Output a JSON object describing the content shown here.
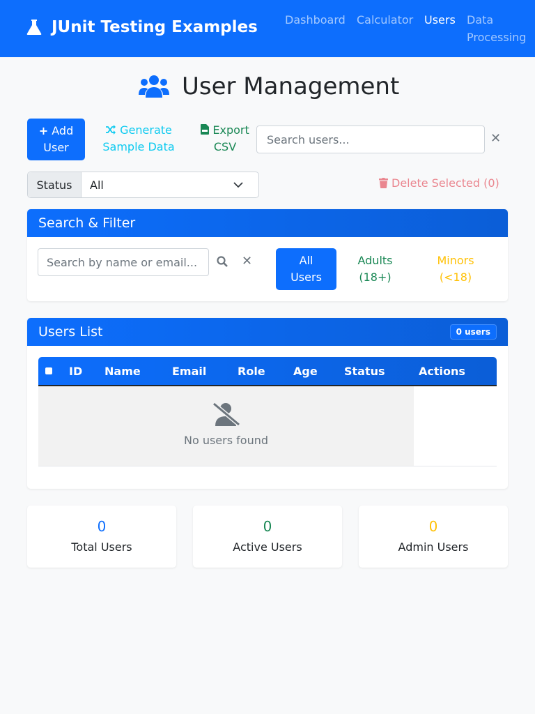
{
  "navbar": {
    "brand": "JUnit Testing Examples",
    "links": [
      "Dashboard",
      "Calculator",
      "Users",
      "Data",
      "Processing"
    ],
    "active": "Users"
  },
  "page": {
    "title": "User Management"
  },
  "toolbar": {
    "add_line1": "Add",
    "add_line2": "User",
    "generate_line1": "Generate",
    "generate_line2": "Sample Data",
    "export_line1": "Export",
    "export_line2": "CSV",
    "search_placeholder": "Search users...",
    "clear": "✕"
  },
  "status_filter": {
    "label": "Status",
    "selected": "All",
    "delete_selected": "Delete Selected (0)"
  },
  "search_filter": {
    "title": "Search & Filter",
    "placeholder": "Search by name or email...",
    "clear": "✕",
    "buttons": {
      "all_line1": "All",
      "all_line2": "Users",
      "adults_line1": "Adults",
      "adults_line2": "(18+)",
      "minors_line1": "Minors",
      "minors_line2": "(<18)"
    }
  },
  "users_list": {
    "title": "Users List",
    "badge": "0 users",
    "columns": [
      "ID",
      "Name",
      "Email",
      "Role",
      "Age",
      "Status",
      "Actions"
    ],
    "empty_text": "No users found"
  },
  "stats": [
    {
      "value": "0",
      "label": "Total Users",
      "color": "#0d6efd"
    },
    {
      "value": "0",
      "label": "Active Users",
      "color": "#198754"
    },
    {
      "value": "0",
      "label": "Admin Users",
      "color": "#ffc107"
    }
  ]
}
